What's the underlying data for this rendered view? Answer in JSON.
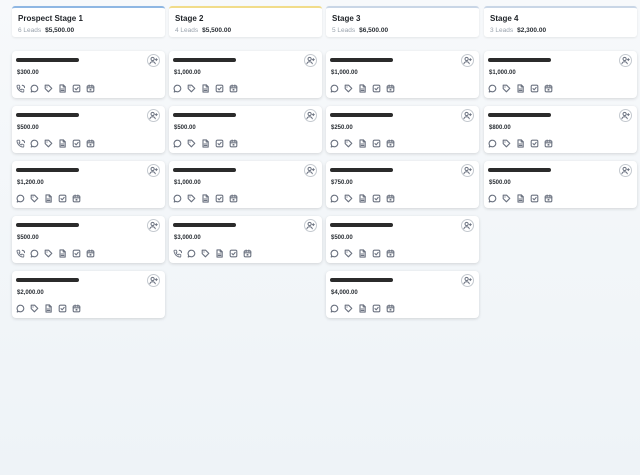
{
  "columns": [
    {
      "title": "Prospect Stage 1",
      "leads": "6 Leads",
      "total": "$5,500.00",
      "accent": "#8fb7e3",
      "cards": [
        {
          "amount": "$300.00",
          "icons": [
            "phone-icon",
            "chat-icon",
            "tag-icon",
            "document-icon",
            "checkbox-icon",
            "calendar-icon"
          ]
        },
        {
          "amount": "$500.00",
          "icons": [
            "phone-icon",
            "chat-icon",
            "tag-icon",
            "document-icon",
            "checkbox-icon",
            "calendar-icon"
          ]
        },
        {
          "amount": "$1,200.00",
          "icons": [
            "chat-icon",
            "tag-icon",
            "document-icon",
            "checkbox-icon",
            "calendar-icon"
          ]
        },
        {
          "amount": "$500.00",
          "icons": [
            "phone-icon",
            "chat-icon",
            "tag-icon",
            "document-icon",
            "checkbox-icon",
            "calendar-icon"
          ]
        },
        {
          "amount": "$2,000.00",
          "icons": [
            "chat-icon",
            "tag-icon",
            "document-icon",
            "checkbox-icon",
            "calendar-icon"
          ]
        }
      ]
    },
    {
      "title": "Stage 2",
      "leads": "4 Leads",
      "total": "$5,500.00",
      "accent": "#f1dc8a",
      "cards": [
        {
          "amount": "$1,000.00",
          "icons": [
            "chat-icon",
            "tag-icon",
            "document-icon",
            "checkbox-icon",
            "calendar-icon"
          ]
        },
        {
          "amount": "$500.00",
          "icons": [
            "chat-icon",
            "tag-icon",
            "document-icon",
            "checkbox-icon",
            "calendar-icon"
          ]
        },
        {
          "amount": "$1,000.00",
          "icons": [
            "chat-icon",
            "tag-icon",
            "document-icon",
            "checkbox-icon",
            "calendar-icon"
          ]
        },
        {
          "amount": "$3,000.00",
          "icons": [
            "phone-icon",
            "chat-icon",
            "tag-icon",
            "document-icon",
            "checkbox-icon",
            "calendar-icon"
          ]
        }
      ]
    },
    {
      "title": "Stage 3",
      "leads": "5 Leads",
      "total": "$6,500.00",
      "accent": "#c9d6e6",
      "cards": [
        {
          "amount": "$1,000.00",
          "icons": [
            "chat-icon",
            "tag-icon",
            "document-icon",
            "checkbox-icon",
            "calendar-icon"
          ]
        },
        {
          "amount": "$250.00",
          "icons": [
            "chat-icon",
            "tag-icon",
            "document-icon",
            "checkbox-icon",
            "calendar-icon"
          ]
        },
        {
          "amount": "$750.00",
          "icons": [
            "chat-icon",
            "tag-icon",
            "document-icon",
            "checkbox-icon",
            "calendar-icon"
          ]
        },
        {
          "amount": "$500.00",
          "icons": [
            "chat-icon",
            "tag-icon",
            "document-icon",
            "checkbox-icon",
            "calendar-icon"
          ]
        },
        {
          "amount": "$4,000.00",
          "icons": [
            "chat-icon",
            "tag-icon",
            "document-icon",
            "checkbox-icon",
            "calendar-icon"
          ]
        }
      ]
    },
    {
      "title": "Stage 4",
      "leads": "3 Leads",
      "total": "$2,300.00",
      "accent": "#c9d6e6",
      "cards": [
        {
          "amount": "$1,000.00",
          "icons": [
            "chat-icon",
            "tag-icon",
            "document-icon",
            "checkbox-icon",
            "calendar-icon"
          ]
        },
        {
          "amount": "$800.00",
          "icons": [
            "chat-icon",
            "tag-icon",
            "document-icon",
            "checkbox-icon",
            "calendar-icon"
          ]
        },
        {
          "amount": "$500.00",
          "icons": [
            "chat-icon",
            "tag-icon",
            "document-icon",
            "checkbox-icon",
            "calendar-icon"
          ]
        }
      ]
    }
  ]
}
